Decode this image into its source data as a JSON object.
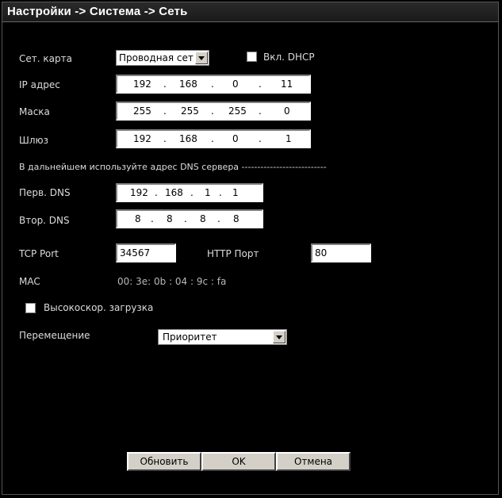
{
  "title": "Настройки -> Система -> Сеть",
  "net_card": {
    "label": "Сет. карта",
    "value": "Проводная сет"
  },
  "dhcp": {
    "label": "Вкл. DHCP",
    "checked": false
  },
  "ip": {
    "label": "IP адрес",
    "octets": [
      "192",
      "168",
      "0",
      "11"
    ]
  },
  "mask": {
    "label": "Маска",
    "octets": [
      "255",
      "255",
      "255",
      "0"
    ]
  },
  "gateway": {
    "label": "Шлюз",
    "octets": [
      "192",
      "168",
      "0",
      "1"
    ]
  },
  "dns_note": "В дальнейшем используйте адрес DNS сервера ---------------------------",
  "dns1": {
    "label": "Перв. DNS",
    "octets": [
      "192",
      "168",
      "1",
      "1"
    ]
  },
  "dns2": {
    "label": "Втор. DNS",
    "octets": [
      "8",
      "8",
      "8",
      "8"
    ]
  },
  "tcp": {
    "label": "TCP Port",
    "value": "34567"
  },
  "http": {
    "label": "HTTP Порт",
    "value": "80"
  },
  "mac": {
    "label": "MAC",
    "value": "00: 3e: 0b :  04 :  9c :  fa"
  },
  "fast_download": {
    "label": "Высокоскор. загрузка",
    "checked": false
  },
  "transfer": {
    "label": "Перемещение",
    "value": "Приоритет"
  },
  "buttons": {
    "refresh": "Обновить",
    "ok": "OK",
    "cancel": "Отмена"
  },
  "colors": {
    "background": "#000000",
    "text": "#dcdcdc",
    "button": "#d4d0c8"
  }
}
